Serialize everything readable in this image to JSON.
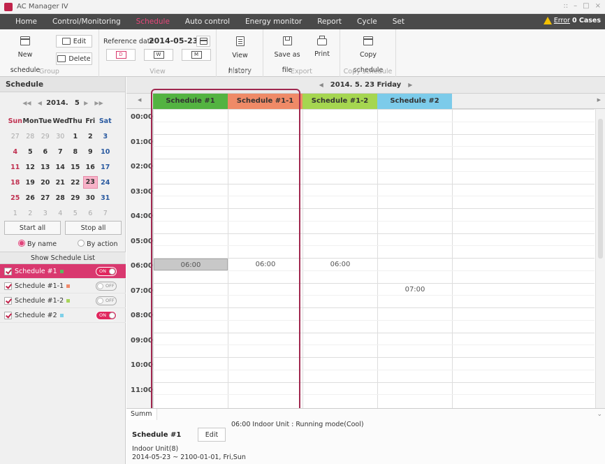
{
  "app": {
    "title": "AC Manager IV",
    "window_controls": [
      "::",
      "–",
      "□",
      "×"
    ]
  },
  "menu": {
    "items": [
      "Home",
      "Control/Monitoring",
      "Schedule",
      "Auto control",
      "Energy monitor",
      "Report",
      "Cycle",
      "Set"
    ],
    "active": "Schedule",
    "error_label": "Error",
    "error_count": "0 Cases"
  },
  "toolbar": {
    "new_schedule": "New schedule",
    "edit": "Edit",
    "delete": "Delete",
    "group_label": "Group",
    "reference_label": "Reference date",
    "reference_date": "2014-05-23",
    "view_d": "D",
    "view_w": "W",
    "view_m": "M",
    "view_label": "View",
    "view_history": "View history",
    "history_label": "History",
    "save_as_file": "Save as file",
    "print": "Print",
    "export_label": "Export",
    "copy_schedule": "Copy schedule",
    "copy_label": "Copy schedule"
  },
  "left": {
    "header": "Schedule",
    "calendar": {
      "year": "2014.",
      "month": "5",
      "weekdays": [
        "Sun",
        "Mon",
        "Tue",
        "Wed",
        "Thu",
        "Fri",
        "Sat"
      ],
      "weeks": [
        [
          "27",
          "28",
          "29",
          "30",
          "1",
          "2",
          "3"
        ],
        [
          "4",
          "5",
          "6",
          "7",
          "8",
          "9",
          "10"
        ],
        [
          "11",
          "12",
          "13",
          "14",
          "15",
          "16",
          "17"
        ],
        [
          "18",
          "19",
          "20",
          "21",
          "22",
          "23",
          "24"
        ],
        [
          "25",
          "26",
          "27",
          "28",
          "29",
          "30",
          "31"
        ],
        [
          "1",
          "2",
          "3",
          "4",
          "5",
          "6",
          "7"
        ]
      ],
      "today": "23"
    },
    "start_all": "Start all",
    "stop_all": "Stop all",
    "by_name": "By name",
    "by_action": "By action",
    "show_list": "Show Schedule List",
    "schedules": [
      {
        "name": "Schedule #1",
        "color": "#5cb85c",
        "state": "ON"
      },
      {
        "name": "Schedule #1-1",
        "color": "#f08a6a",
        "state": "OFF"
      },
      {
        "name": "Schedule #1-2",
        "color": "#a8d45a",
        "state": "OFF"
      },
      {
        "name": "Schedule #2",
        "color": "#7fd0e8",
        "state": "ON"
      }
    ]
  },
  "main": {
    "date": "2014. 5. 23 Friday",
    "columns": [
      {
        "name": "Schedule #1",
        "color": "#53b341"
      },
      {
        "name": "Schedule #1-1",
        "color": "#ef8a67"
      },
      {
        "name": "Schedule #1-2",
        "color": "#a5d650"
      },
      {
        "name": "Schedule #2",
        "color": "#7ccbea"
      }
    ],
    "hours": [
      "00:00",
      "01:00",
      "02:00",
      "03:00",
      "04:00",
      "05:00",
      "06:00",
      "07:00",
      "08:00",
      "09:00",
      "10:00",
      "11:00"
    ],
    "events": [
      {
        "column": 0,
        "time": "06:00"
      },
      {
        "column": 1,
        "time": "06:00"
      },
      {
        "column": 2,
        "time": "06:00"
      },
      {
        "column": 3,
        "time": "07:00"
      }
    ]
  },
  "summary": {
    "tab": "Summ",
    "line": "06:00 Indoor Unit : Running mode(Cool)",
    "name": "Schedule #1",
    "edit": "Edit",
    "unit": "Indoor Unit(8)",
    "range": "2014-05-23 ~ 2100-01-01, Fri,Sun"
  }
}
